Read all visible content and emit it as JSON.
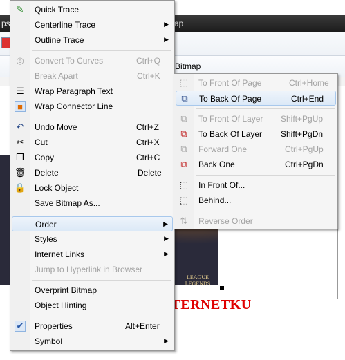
{
  "app": {
    "title_fragments": [
      "ps",
      "ap"
    ],
    "toolbar_label": "Bitmap"
  },
  "watermark": "ZONA INTERNETKU",
  "game_logo": "LEAGUE\nLEGENDS",
  "context_menu": {
    "items": [
      {
        "id": "quick-trace",
        "label": "Quick Trace",
        "accel": "Q",
        "icon": "quick-trace-icon",
        "enabled": true,
        "submenu": false
      },
      {
        "id": "centerline-trace",
        "label": "Centerline Trace",
        "accel": "C",
        "enabled": true,
        "submenu": true
      },
      {
        "id": "outline-trace",
        "label": "Outline Trace",
        "accel": "O",
        "enabled": true,
        "submenu": true
      },
      {
        "id": "convert-to-curves",
        "label": "Convert To Curves",
        "shortcut": "Ctrl+Q",
        "icon": "convert-curves-icon",
        "enabled": false
      },
      {
        "id": "break-apart",
        "label": "Break Apart",
        "shortcut": "Ctrl+K",
        "enabled": false
      },
      {
        "id": "wrap-paragraph-text",
        "label": "Wrap Paragraph Text",
        "icon": "wrap-text-icon",
        "enabled": true
      },
      {
        "id": "wrap-connector-line",
        "label": "Wrap Connector Line",
        "icon": "wrap-connector-icon",
        "enabled": true,
        "checked": true
      },
      {
        "id": "undo-move",
        "label": "Undo Move",
        "shortcut": "Ctrl+Z",
        "icon": "undo-icon",
        "enabled": true
      },
      {
        "id": "cut",
        "label": "Cut",
        "shortcut": "Ctrl+X",
        "icon": "scissors-icon",
        "enabled": true
      },
      {
        "id": "copy",
        "label": "Copy",
        "shortcut": "Ctrl+C",
        "icon": "copy-icon",
        "enabled": true
      },
      {
        "id": "delete",
        "label": "Delete",
        "shortcut": "Delete",
        "icon": "trash-icon",
        "enabled": true
      },
      {
        "id": "lock-object",
        "label": "Lock Object",
        "icon": "lock-icon",
        "enabled": true
      },
      {
        "id": "save-bitmap-as",
        "label": "Save Bitmap As...",
        "enabled": true
      },
      {
        "id": "order",
        "label": "Order",
        "enabled": true,
        "submenu": true,
        "highlighted": true
      },
      {
        "id": "styles",
        "label": "Styles",
        "enabled": true,
        "submenu": true
      },
      {
        "id": "internet-links",
        "label": "Internet Links",
        "enabled": true,
        "submenu": true
      },
      {
        "id": "jump-to-hyperlink",
        "label": "Jump to Hyperlink in Browser",
        "enabled": false
      },
      {
        "id": "overprint-bitmap",
        "label": "Overprint Bitmap",
        "enabled": true
      },
      {
        "id": "object-hinting",
        "label": "Object Hinting",
        "enabled": true
      },
      {
        "id": "properties",
        "label": "Properties",
        "shortcut": "Alt+Enter",
        "enabled": true,
        "checked": true
      },
      {
        "id": "symbol",
        "label": "Symbol",
        "enabled": true,
        "submenu": true
      }
    ]
  },
  "order_submenu": {
    "items": [
      {
        "id": "to-front-of-page",
        "label": "To Front Of Page",
        "shortcut": "Ctrl+Home",
        "icon": "front-of-page-icon",
        "enabled": false
      },
      {
        "id": "to-back-of-page",
        "label": "To Back Of Page",
        "shortcut": "Ctrl+End",
        "icon": "back-of-page-icon",
        "enabled": true,
        "highlighted": true
      },
      {
        "id": "to-front-of-layer",
        "label": "To Front Of Layer",
        "shortcut": "Shift+PgUp",
        "icon": "front-of-layer-icon",
        "enabled": false
      },
      {
        "id": "to-back-of-layer",
        "label": "To Back Of Layer",
        "shortcut": "Shift+PgDn",
        "icon": "back-of-layer-icon",
        "enabled": true
      },
      {
        "id": "forward-one",
        "label": "Forward One",
        "shortcut": "Ctrl+PgUp",
        "icon": "forward-one-icon",
        "enabled": false
      },
      {
        "id": "back-one",
        "label": "Back One",
        "shortcut": "Ctrl+PgDn",
        "icon": "back-one-icon",
        "enabled": true
      },
      {
        "id": "in-front-of",
        "label": "In Front Of...",
        "icon": "in-front-of-icon",
        "enabled": true
      },
      {
        "id": "behind",
        "label": "Behind...",
        "icon": "behind-icon",
        "enabled": true
      },
      {
        "id": "reverse-order",
        "label": "Reverse Order",
        "icon": "reverse-order-icon",
        "enabled": false
      }
    ]
  },
  "colors": {
    "menu_bg": "#f5f5f5",
    "highlight_bg": "#dce9f7",
    "highlight_border": "#a8c8ec",
    "disabled_text": "#a3a3a3",
    "watermark": "#e00000"
  }
}
